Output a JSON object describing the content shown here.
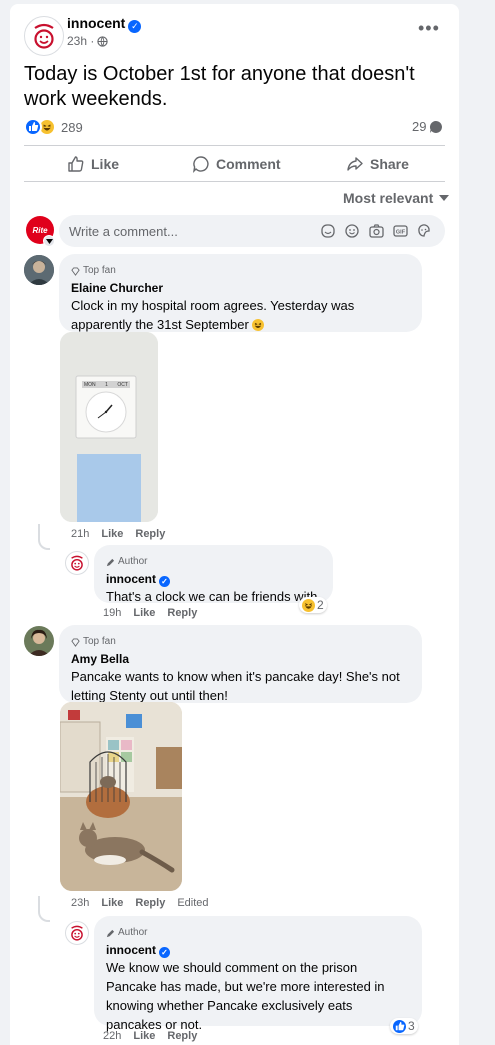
{
  "post": {
    "page_name": "innocent",
    "time": "23h ·",
    "text": "Today is October 1st for anyone that doesn't work weekends.",
    "reaction_count": "289",
    "comment_count": "29"
  },
  "actions": {
    "like": "Like",
    "comment": "Comment",
    "share": "Share"
  },
  "sort": {
    "label": "Most relevant"
  },
  "composer": {
    "placeholder": "Write a comment...",
    "avatar_text": "Rite"
  },
  "comments": [
    {
      "badge": "Top fan",
      "name": "Elaine Churcher",
      "text": "Clock in my hospital room agrees. Yesterday was apparently the 31st September",
      "time": "21h",
      "like": "Like",
      "reply": "Reply",
      "clock_labels": {
        "day": "MON",
        "date": "1",
        "month": "OCT"
      },
      "reply_comment": {
        "badge": "Author",
        "name": "innocent",
        "text": "That's a clock we can be friends with.",
        "time": "19h",
        "like": "Like",
        "reply": "Reply",
        "reaction_count": "2"
      }
    },
    {
      "badge": "Top fan",
      "name": "Amy Bella",
      "text": "Pancake wants to know when it's pancake day! She's not letting Stenty out until then!",
      "time": "23h",
      "like": "Like",
      "reply": "Reply",
      "edited": "Edited",
      "reply_comment": {
        "badge": "Author",
        "name": "innocent",
        "text": "We know we should comment on the prison Pancake has made, but we're more interested in knowing whether Pancake exclusively eats pancakes or not.",
        "time": "22h",
        "like": "Like",
        "reply": "Reply",
        "reaction_count": "3"
      }
    }
  ],
  "colors": {
    "brand_blue": "#0866ff",
    "bubble_bg": "#f0f2f5",
    "muted": "#65676b"
  }
}
